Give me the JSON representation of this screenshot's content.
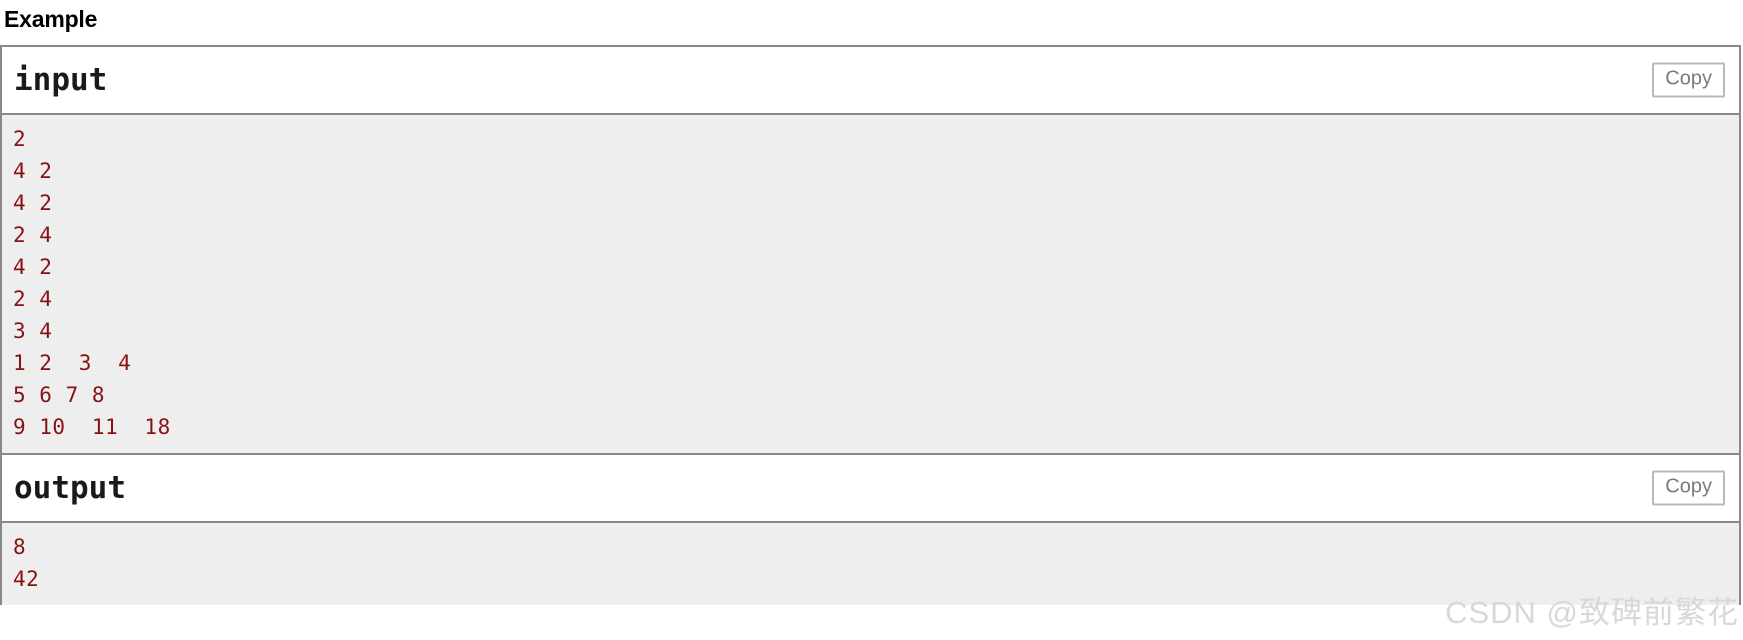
{
  "section": {
    "title": "Example"
  },
  "blocks": [
    {
      "title": "input",
      "copy_label": "Copy",
      "lines": [
        "2",
        "4 2",
        "4 2",
        "2 4",
        "4 2",
        "2 4",
        "3 4",
        "1 2  3  4",
        "5 6 7 8",
        "9 10  11  18"
      ]
    },
    {
      "title": "output",
      "copy_label": "Copy",
      "lines": [
        "8",
        "42"
      ]
    }
  ],
  "watermark": {
    "text": "CSDN @致碑前繁花"
  },
  "colors": {
    "data_text": "#8b1111",
    "data_bg": "#eeeeee",
    "border": "#888888",
    "copy_text": "#7a7a7a",
    "watermark": "#d8d8d8"
  }
}
